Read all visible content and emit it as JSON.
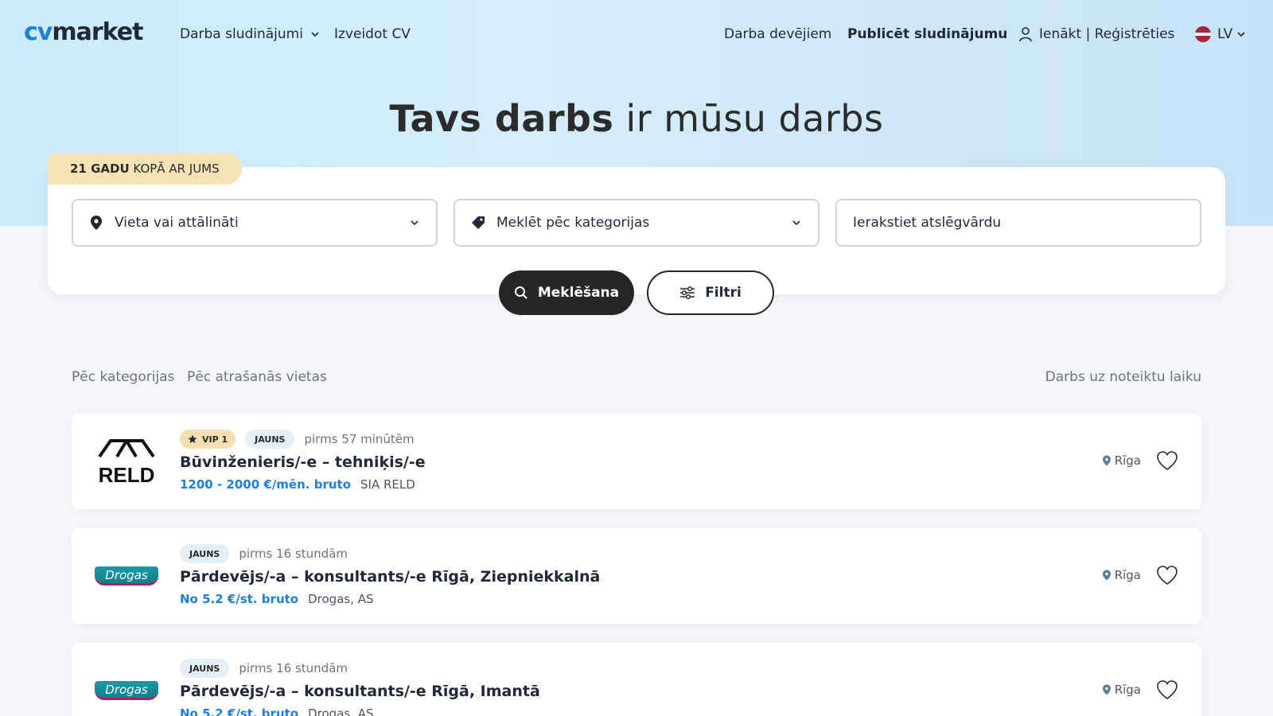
{
  "brand": {
    "cv": "cv",
    "market": "market",
    "accent": "#1f7fd6"
  },
  "nav": {
    "jobs": "Darba sludinājumi",
    "create_cv": "Izveidot CV",
    "employers": "Darba devējiem",
    "publish": "Publicēt sludinājumu",
    "login": "Ienākt | Reģistrēties",
    "lang": "LV"
  },
  "hero": {
    "title_bold": "Tavs darbs",
    "title_rest": " ir mūsu darbs"
  },
  "badge": {
    "bold": "21 GADU",
    "rest": " KOPĀ AR JUMS"
  },
  "search": {
    "location": "Vieta vai attālināti",
    "category": "Meklēt pēc kategorijas",
    "keyword_placeholder": "Ierakstiet atslēgvārdu",
    "search_button": "Meklēšana",
    "filter_button": "Filtri"
  },
  "tabs": {
    "by_category": "Pēc kategorijas",
    "by_location": "Pēc atrašanās vietas",
    "temporary": "Darbs uz noteiktu laiku"
  },
  "jobs": [
    {
      "vip": "VIP 1",
      "new": "JAUNS",
      "time": "pirms 57 minūtēm",
      "title": "Būvinženieris/-e – tehniķis/-e",
      "salary": "1200 - 2000 €/mēn. bruto",
      "company": "SIA RELD",
      "location": "Rīga",
      "logo": "RELD"
    },
    {
      "new": "JAUNS",
      "time": "pirms 16 stundām",
      "title": "Pārdevējs/-a – konsultants/-e Rīgā, Ziepniekkalnā",
      "salary": "No 5.2 €/st. bruto",
      "company": "Drogas, AS",
      "location": "Rīga",
      "logo": "Drogas"
    },
    {
      "new": "JAUNS",
      "time": "pirms 16 stundām",
      "title": "Pārdevējs/-a – konsultants/-e Rīgā, Imantā",
      "salary": "No 5.2 €/st. bruto",
      "company": "Drogas, AS",
      "location": "Rīga",
      "logo": "Drogas"
    }
  ]
}
